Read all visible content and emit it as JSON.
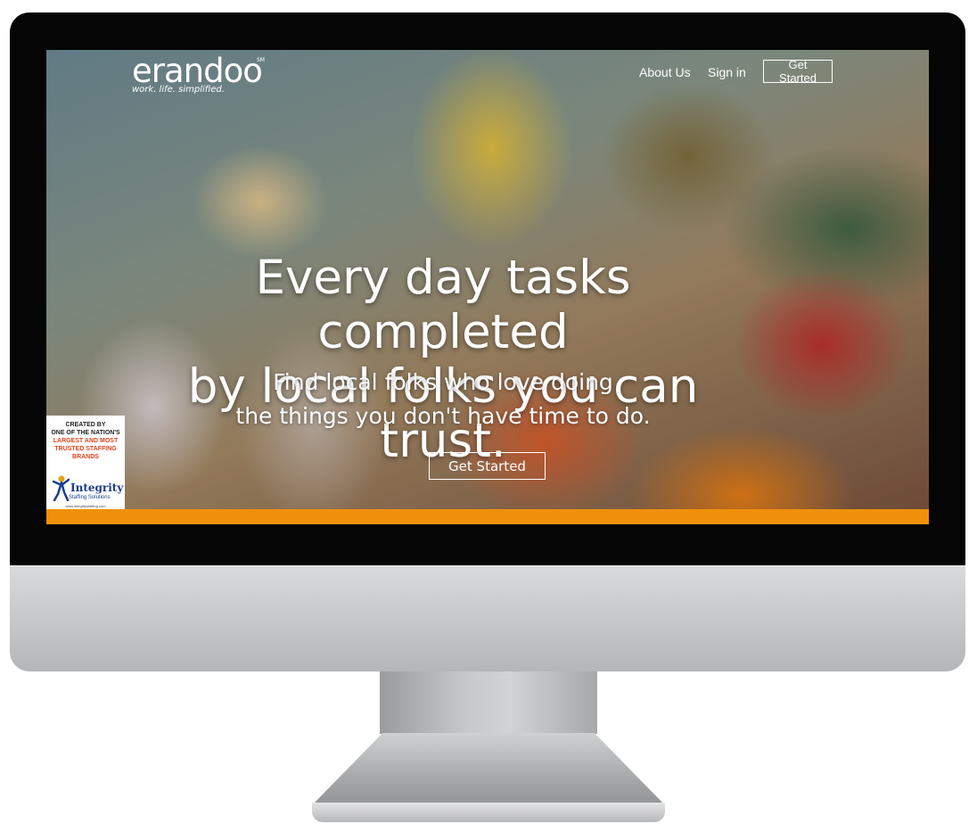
{
  "brand": {
    "name": "erandoo",
    "trademark": "SM",
    "tagline": "work. life. simplified."
  },
  "nav": {
    "about_label": "About Us",
    "signin_label": "Sign in",
    "get_started_label": "Get Started"
  },
  "hero": {
    "headline_line1": "Every day tasks completed",
    "headline_line2": "by local folks you can trust.",
    "subline_line1": "Find local folks who love doing",
    "subline_line2": "the things you don't have time to do.",
    "cta_label": "Get Started"
  },
  "badge": {
    "line1": "CREATED BY",
    "line2": "ONE OF THE NATION'S",
    "line3": "LARGEST AND MOST",
    "line4": "TRUSTED STAFFING",
    "line5": "BRANDS",
    "logo_name": "Integrity",
    "logo_sub": "Staffing Solutions",
    "logo_url": "www.integritystaffing.com"
  },
  "colors": {
    "accent_bar": "#f0900a",
    "badge_highlight": "#e0441a",
    "badge_logo": "#1a3d8f"
  }
}
